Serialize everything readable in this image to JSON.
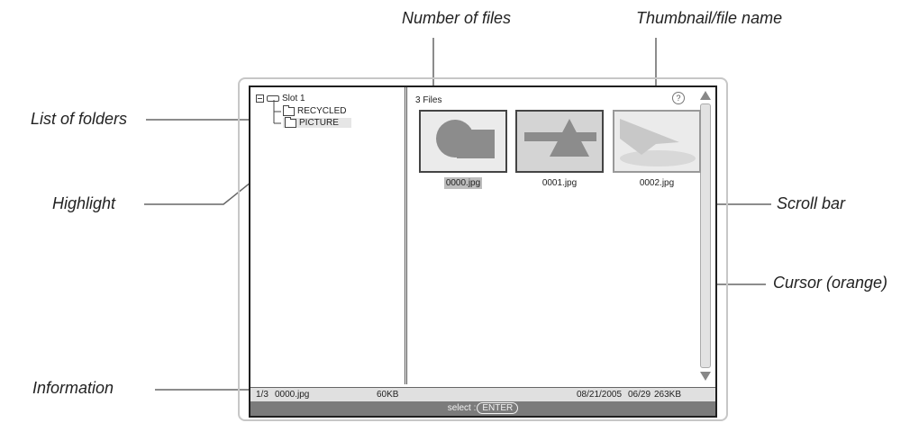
{
  "callouts": {
    "number_of_files": "Number of files",
    "thumbnail_file_name": "Thumbnail/file name",
    "list_of_folders": "List of folders",
    "highlight": "Highlight",
    "scroll_bar": "Scroll bar",
    "cursor": "Cursor (orange)",
    "information": "Information"
  },
  "tree": {
    "root": "Slot 1",
    "folders": [
      "RECYCLED",
      "PICTURE"
    ],
    "highlighted": "PICTURE"
  },
  "file_count": "3 Files",
  "help_glyph": "?",
  "files": [
    {
      "name": "0000.jpg",
      "selected": true
    },
    {
      "name": "0001.jpg",
      "selected": false
    },
    {
      "name": "0002.jpg",
      "selected": false
    }
  ],
  "info": {
    "index": "1/3",
    "name": "0000.jpg",
    "size": "60KB",
    "date": "08/21/2005",
    "time": "06/29",
    "total": "263KB"
  },
  "status": {
    "prefix": "select :",
    "key": "ENTER"
  },
  "colors": {
    "frame": "#1f1f1f",
    "thumb_bg": "#d4d4d4",
    "thumb_shape": "#8c8c8c",
    "status_bar": "#7b7b7b",
    "highlight": "#e6e6e6",
    "cursor": "#bdbdbd"
  }
}
